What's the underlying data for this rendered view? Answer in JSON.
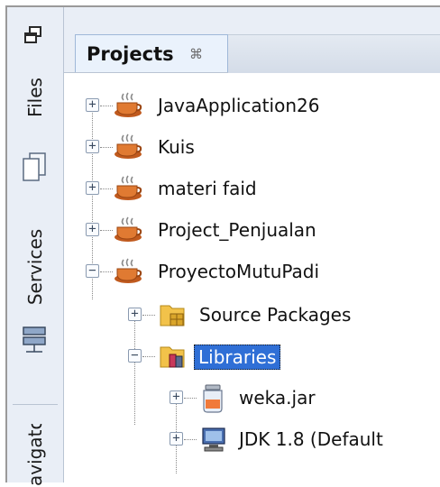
{
  "sidebar": {
    "tabs": [
      {
        "label": "Files",
        "icon": "files-icon"
      },
      {
        "label": "Services",
        "icon": "services-icon"
      },
      {
        "label": "Navigator"
      }
    ],
    "restore_icon": "restore-window-icon"
  },
  "header": {
    "active_tab": {
      "label": "Projects",
      "close_icon": "close-icon"
    }
  },
  "tree": {
    "projects": [
      {
        "label": "JavaApplication26",
        "icon": "java-project-icon",
        "expanded": false
      },
      {
        "label": "Kuis",
        "icon": "java-project-icon",
        "expanded": false
      },
      {
        "label": "materi faid",
        "icon": "java-project-icon",
        "expanded": false
      },
      {
        "label": "Project_Penjualan",
        "icon": "java-project-icon",
        "expanded": false
      },
      {
        "label": "ProyectoMutuPadi",
        "icon": "java-project-icon",
        "expanded": true,
        "children": [
          {
            "label": "Source Packages",
            "icon": "source-packages-icon",
            "expanded": false
          },
          {
            "label": "Libraries",
            "icon": "libraries-icon",
            "expanded": true,
            "selected": true,
            "children": [
              {
                "label": "weka.jar",
                "icon": "jar-icon",
                "expanded": false
              },
              {
                "label": "JDK 1.8 (Default",
                "icon": "jdk-icon",
                "expanded": false
              }
            ]
          }
        ]
      }
    ]
  },
  "colors": {
    "selection": "#2f6fd6",
    "panel": "#e9eef6",
    "border": "#b9c4d3"
  }
}
